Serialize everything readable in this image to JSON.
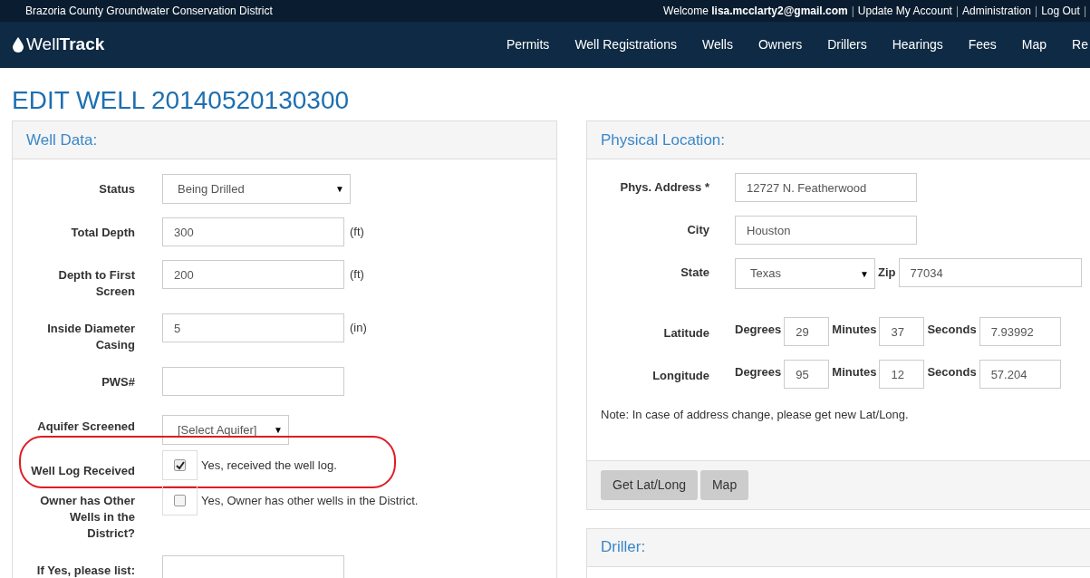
{
  "top_bar": {
    "org": "Brazoria County Groundwater Conservation District",
    "welcome": "Welcome",
    "user": "lisa.mcclarty2@gmail.com",
    "links": [
      "Update My Account",
      "Administration",
      "Log Out"
    ],
    "separator": "|"
  },
  "nav": {
    "brand_light": "Well",
    "brand_bold": "Track",
    "items": [
      "Permits",
      "Well Registrations",
      "Wells",
      "Owners",
      "Drillers",
      "Hearings",
      "Fees",
      "Map",
      "Re"
    ]
  },
  "page_title": "EDIT WELL 20140520130300",
  "well_data": {
    "title": "Well Data:",
    "fields": [
      {
        "kind": "select",
        "label": "Status",
        "value": "Being Drilled",
        "caret": "▼"
      },
      {
        "kind": "text",
        "label": "Total Depth",
        "value": "300",
        "unit": "(ft)"
      },
      {
        "kind": "text",
        "label": "Depth to First Screen",
        "value": "200",
        "unit": "(ft)"
      },
      {
        "kind": "text",
        "label": "Inside Diameter Casing",
        "value": "5",
        "unit": "(in)"
      },
      {
        "kind": "text",
        "label": "PWS#"
      },
      {
        "kind": "select",
        "label": "Aquifer Screened",
        "value": "[Select Aquifer]",
        "caret": "▼"
      },
      {
        "kind": "checkbox",
        "label": "Well Log Received",
        "checked": true,
        "text": "Yes, received the well log.",
        "circled": true
      },
      {
        "kind": "checkbox",
        "label": "Owner has Other Wells in the District?",
        "checked": false,
        "text": "Yes, Owner has other wells in the District.",
        "circled": false
      },
      {
        "kind": "text",
        "label": "If Yes, please list:"
      }
    ]
  },
  "physical_location": {
    "title": "Physical Location:",
    "address_label": "Phys. Address *",
    "address": "12727 N. Featherwood",
    "city_label": "City",
    "city": "Houston",
    "state_label": "State",
    "state": "Texas",
    "state_caret": "▼",
    "zip_label": "Zip",
    "zip": "77034",
    "coords": [
      {
        "label": "Latitude",
        "parts": [
          {
            "label": "Degrees",
            "value": "29"
          },
          {
            "label": "Minutes",
            "value": "37"
          },
          {
            "label": "Seconds",
            "value": "7.93992"
          }
        ]
      },
      {
        "label": "Longitude",
        "parts": [
          {
            "label": "Degrees",
            "value": "95"
          },
          {
            "label": "Minutes",
            "value": "12"
          },
          {
            "label": "Seconds",
            "value": "57.204"
          }
        ]
      }
    ],
    "note": "Note: In case of address change, please get new Lat/Long.",
    "buttons": [
      "Get Lat/Long",
      "Map"
    ]
  },
  "driller": {
    "title": "Driller:"
  }
}
